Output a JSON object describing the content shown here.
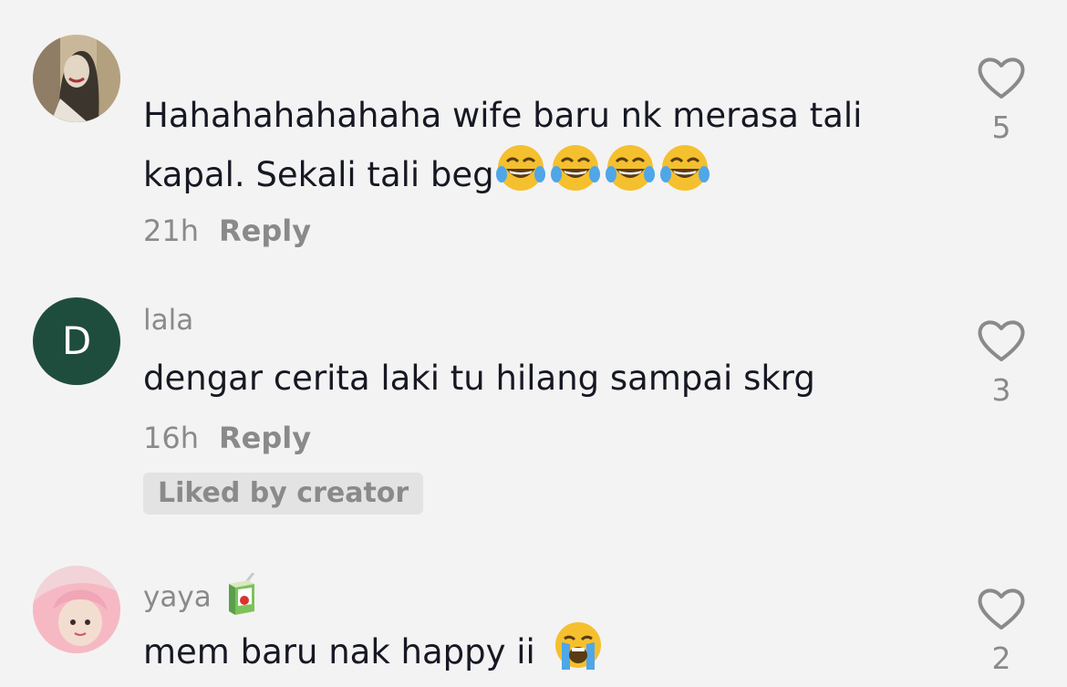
{
  "comments": [
    {
      "username": "",
      "line1": "Hahahahahahaha wife baru nk merasa tali",
      "line2": "kapal. Sekali tali beg",
      "emoji": "face-with-tears-of-joy x4",
      "time": "21h",
      "reply_label": "Reply",
      "likes": "5",
      "avatar": "photo-avatar"
    },
    {
      "username": "lala",
      "avatar_letter": "D",
      "avatar_color": "#1f4d3d",
      "text": "dengar cerita laki tu hilang sampai skrg",
      "time": "16h",
      "reply_label": "Reply",
      "badge": "Liked by creator",
      "likes": "3"
    },
    {
      "username": "yaya",
      "username_icon": "juice-box-icon",
      "text": "mem baru nak happy ii",
      "emoji": "loudly-crying-face",
      "likes": "2",
      "avatar": "photo-avatar"
    }
  ],
  "colors": {
    "background": "#f4f3f3",
    "text_primary": "#161823",
    "text_secondary": "#8a8a8a",
    "badge_bg": "#e4e3e3"
  }
}
